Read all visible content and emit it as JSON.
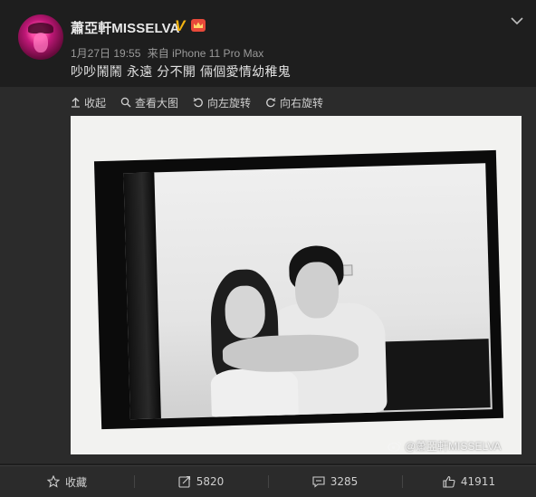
{
  "post": {
    "username": "蕭亞軒MISSELVA",
    "verified_badge": "V",
    "date": "1月27日 19:55",
    "source": "来自 iPhone 11 Pro Max",
    "text": "吵吵鬧鬧 永遠 分不開 倆個愛情幼稚鬼"
  },
  "toolbar": {
    "collapse_label": "收起",
    "view_large_label": "查看大图",
    "rotate_left_label": "向左旋转",
    "rotate_right_label": "向右旋转"
  },
  "image": {
    "watermark": "@蕭亞軒MISSELVA"
  },
  "actions": {
    "favorite_label": "收藏",
    "repost_count": "5820",
    "comment_count": "3285",
    "like_count": "41911"
  },
  "colors": {
    "background": "#1e1e1e",
    "panel": "#2b2b2b",
    "badge": "#f2b311",
    "crown": "#e8493a"
  }
}
